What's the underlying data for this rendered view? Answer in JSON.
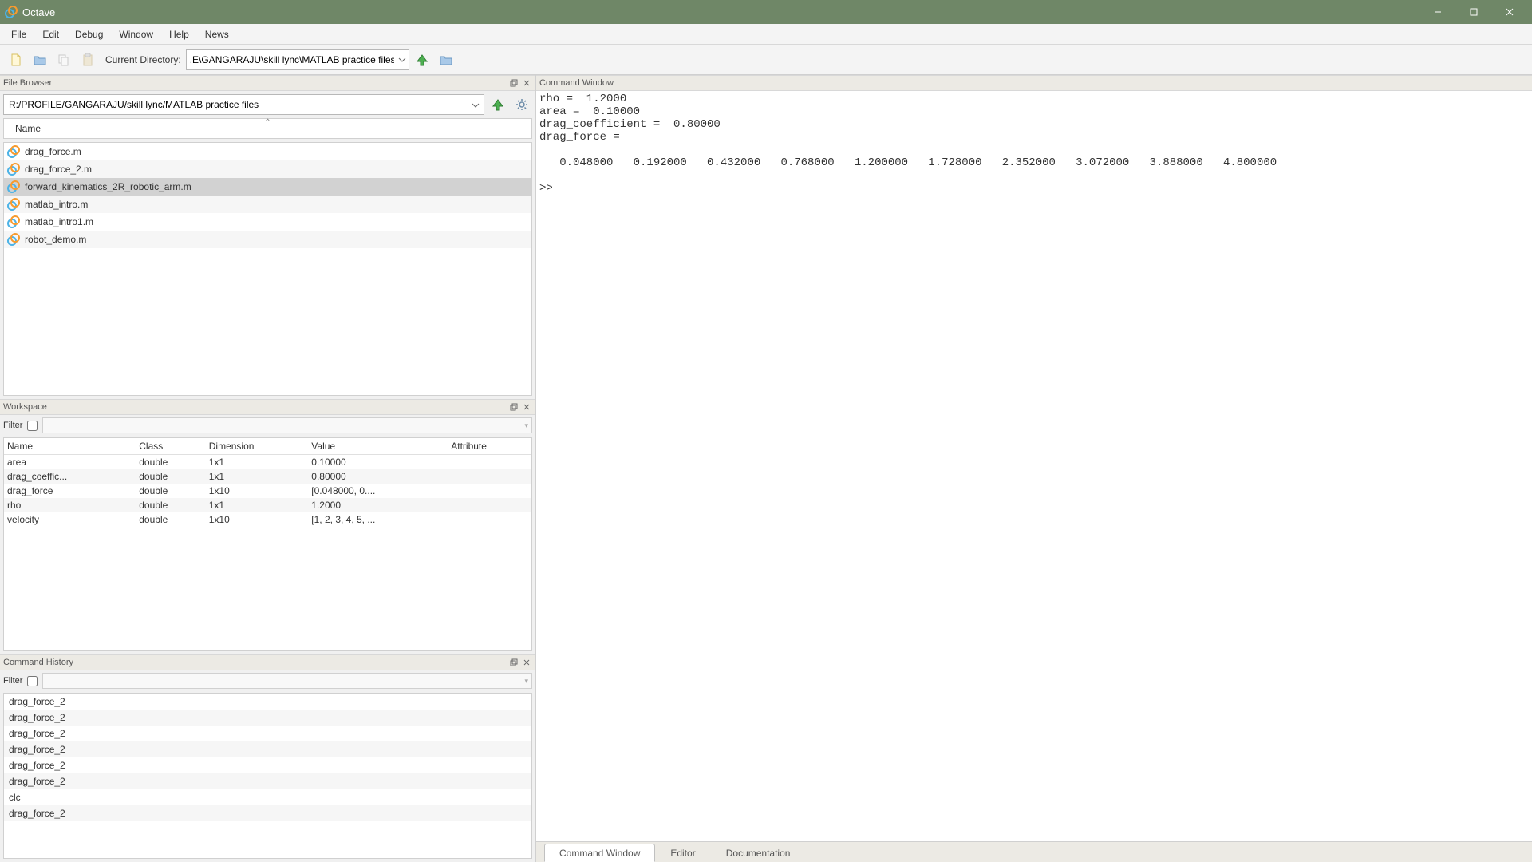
{
  "titlebar": {
    "title": "Octave"
  },
  "menu": [
    "File",
    "Edit",
    "Debug",
    "Window",
    "Help",
    "News"
  ],
  "toolbar": {
    "current_dir_label": "Current Directory:",
    "current_dir_value": ".E\\GANGARAJU\\skill lync\\MATLAB practice files"
  },
  "file_browser": {
    "title": "File Browser",
    "path": "R:/PROFILE/GANGARAJU/skill lync/MATLAB practice files",
    "name_header": "Name",
    "files": [
      {
        "name": "drag_force.m",
        "selected": false
      },
      {
        "name": "drag_force_2.m",
        "selected": false
      },
      {
        "name": "forward_kinematics_2R_robotic_arm.m",
        "selected": true
      },
      {
        "name": "matlab_intro.m",
        "selected": false
      },
      {
        "name": "matlab_intro1.m",
        "selected": false
      },
      {
        "name": "robot_demo.m",
        "selected": false
      }
    ]
  },
  "workspace": {
    "title": "Workspace",
    "filter_label": "Filter",
    "columns": [
      "Name",
      "Class",
      "Dimension",
      "Value",
      "Attribute"
    ],
    "rows": [
      {
        "name": "area",
        "class": "double",
        "dimension": "1x1",
        "value": "0.10000",
        "attribute": ""
      },
      {
        "name": "drag_coeffic...",
        "class": "double",
        "dimension": "1x1",
        "value": "0.80000",
        "attribute": ""
      },
      {
        "name": "drag_force",
        "class": "double",
        "dimension": "1x10",
        "value": "[0.048000, 0....",
        "attribute": ""
      },
      {
        "name": "rho",
        "class": "double",
        "dimension": "1x1",
        "value": "1.2000",
        "attribute": ""
      },
      {
        "name": "velocity",
        "class": "double",
        "dimension": "1x10",
        "value": "[1, 2, 3, 4, 5, ...",
        "attribute": ""
      }
    ]
  },
  "command_history": {
    "title": "Command History",
    "filter_label": "Filter",
    "items": [
      "drag_force_2",
      "drag_force_2",
      "drag_force_2",
      "drag_force_2",
      "drag_force_2",
      "drag_force_2",
      "clc",
      "drag_force_2"
    ]
  },
  "command_window": {
    "title": "Command Window",
    "lines": [
      "rho =  1.2000",
      "area =  0.10000",
      "drag_coefficient =  0.80000",
      "drag_force =",
      "",
      "   0.048000   0.192000   0.432000   0.768000   1.200000   1.728000   2.352000   3.072000   3.888000   4.800000",
      "",
      ">>"
    ],
    "tabs": [
      "Command Window",
      "Editor",
      "Documentation"
    ],
    "active_tab": 0
  }
}
